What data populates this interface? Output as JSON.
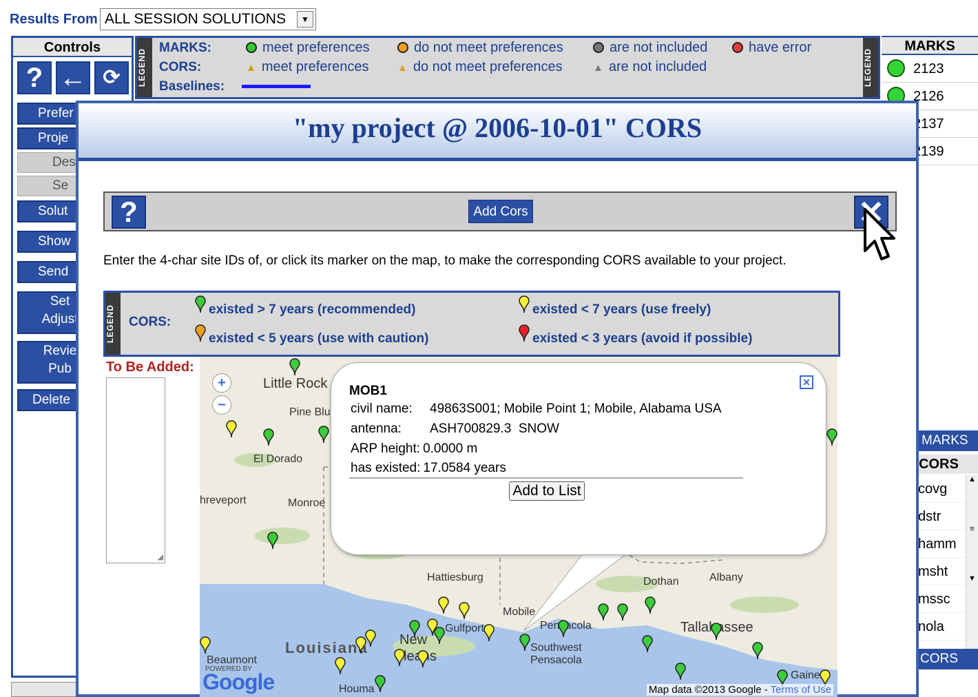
{
  "topbar": {
    "results_label": "Results From",
    "results_value": "ALL SESSION SOLUTIONS"
  },
  "controls": {
    "title": "Controls",
    "icons": [
      "help-icon",
      "back-arrow-icon",
      "refresh-icon"
    ],
    "nav": [
      {
        "label": "Prefer"
      },
      {
        "label": "Proje"
      },
      {
        "label": "Des",
        "sub": true
      },
      {
        "label": "Se",
        "sub": true
      },
      {
        "label": "Solut"
      },
      {
        "label": "Show"
      },
      {
        "label": "Send"
      },
      {
        "label": "Set\nAdjust"
      },
      {
        "label": "Revie\nPub"
      },
      {
        "label": "Delete"
      }
    ]
  },
  "top_legend": {
    "strip": "LEGEND",
    "marks_label": "MARKS:",
    "cors_label": "CORS:",
    "baselines_label": "Baselines:",
    "marks_items": [
      "meet preferences",
      "do not meet preferences",
      "are not included",
      "have error"
    ],
    "cors_items": [
      "meet preferences",
      "do not meet preferences",
      "are not included"
    ],
    "colors": {
      "green": "#2ecc2e",
      "orange": "#f0a020",
      "gray": "#777777",
      "red": "#e33b3b",
      "baseline": "#1a1aff"
    }
  },
  "marks_panel": {
    "title": "MARKS",
    "rows": [
      "2123",
      "2126",
      "2137",
      "2139"
    ]
  },
  "right_lower": {
    "marks_btn": "MARKS",
    "cors_head": "CORS",
    "cors_list": [
      "covg",
      "dstr",
      "hamm",
      "msht",
      "mssc",
      "nola"
    ],
    "add_cors": "CORS"
  },
  "modal": {
    "title": "\"my project @ 2006-10-01\" CORS",
    "add_cors_label": "Add Cors",
    "help_label": "?",
    "close_label": "✕",
    "instructions": "Enter the 4-char site IDs of, or click its marker on the map, to make the corresponding CORS available to your project.",
    "legend": {
      "strip": "LEGEND",
      "label": "CORS:",
      "items": [
        {
          "text": "existed > 7 years (recommended)",
          "color": "#3ccc3c"
        },
        {
          "text": "existed < 7 years (use freely)",
          "color": "#f5f03a"
        },
        {
          "text": "existed < 5 years (use with caution)",
          "color": "#f0a020"
        },
        {
          "text": "existed < 3 years (avoid if possible)",
          "color": "#e8202a"
        }
      ]
    },
    "to_be_added_label": "To Be Added:"
  },
  "map": {
    "cities": [
      "Little Rock",
      "Pine Blu",
      "El Dorado",
      "hreveport",
      "Monroe",
      "Hattiesburg",
      "Mobile",
      "Gulfport",
      "New",
      "leans",
      "Pensacola",
      "Southwest",
      "Pensacola",
      "Dothan",
      "Albany",
      "Tallahassee",
      "Beaumont",
      "Houma",
      "Gaine"
    ],
    "state_label": "Louisiana",
    "zoom_in": "+",
    "zoom_out": "−",
    "google": "Google",
    "powered": "POWERED BY",
    "credits": "Map data ©2013 Google - ",
    "terms": "Terms of Use"
  },
  "balloon": {
    "site_id": "MOB1",
    "civil_name_label": "civil name:",
    "civil_name": "49863S001; Mobile Point 1; Mobile, Alabama USA",
    "antenna_label": "antenna:",
    "antenna": "ASH700829.3  SNOW",
    "arp_label": "ARP height:",
    "arp": "0.0000 m",
    "existed_label": "has existed:",
    "existed": "17.0584 years",
    "add_button": "Add to List"
  }
}
